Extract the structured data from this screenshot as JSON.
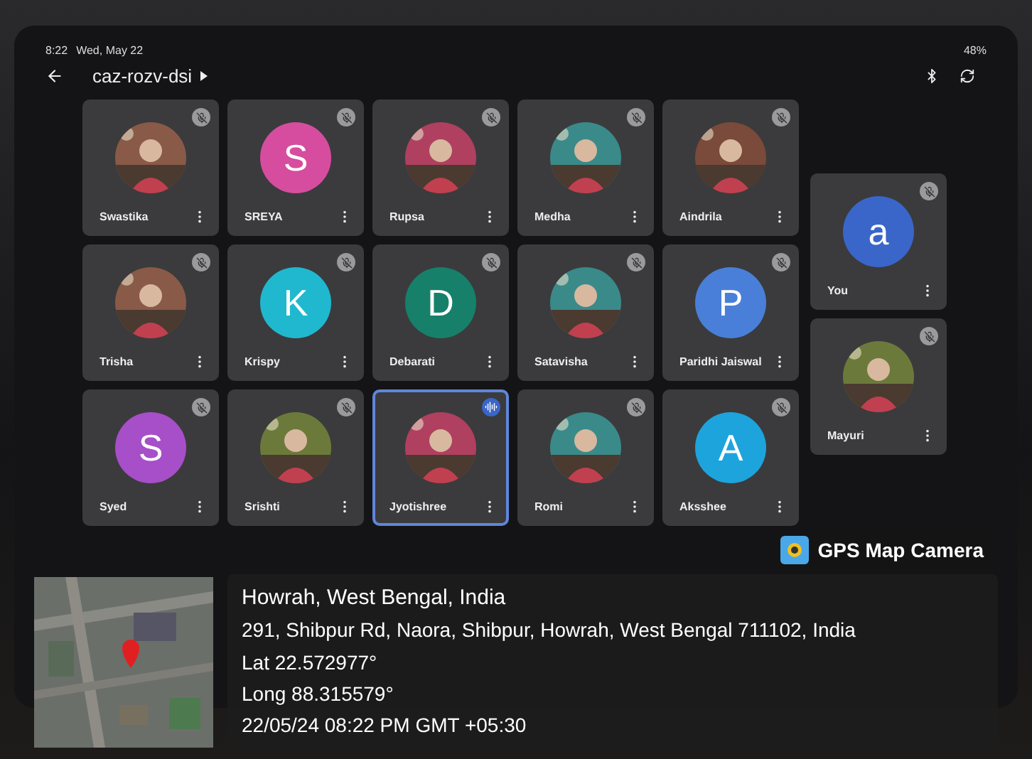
{
  "status_bar": {
    "time": "8:22",
    "date": "Wed, May 22",
    "battery": "48%"
  },
  "meeting": {
    "title": "caz-rozv-dsi"
  },
  "grid": [
    {
      "name": "Swastika",
      "muted": true,
      "speaking": false
    },
    {
      "name": "SREYA",
      "kind": "letter",
      "letter": "S",
      "color": "#d64d9f",
      "muted": true,
      "speaking": false
    },
    {
      "name": "Rupsa",
      "muted": true,
      "speaking": false
    },
    {
      "name": "Medha",
      "muted": true,
      "speaking": false
    },
    {
      "name": "Aindrila",
      "muted": true,
      "speaking": false
    },
    {
      "name": "Trisha",
      "muted": true,
      "speaking": false
    },
    {
      "name": "Krispy",
      "kind": "letter",
      "letter": "K",
      "color": "#20b8cf",
      "muted": true,
      "speaking": false
    },
    {
      "name": "Debarati",
      "kind": "letter",
      "letter": "D",
      "color": "#17806a",
      "muted": true,
      "speaking": false
    },
    {
      "name": "Satavisha",
      "muted": true,
      "speaking": false
    },
    {
      "name": "Paridhi Jaiswal",
      "kind": "letter",
      "letter": "P",
      "color": "#4a7fd9",
      "muted": true,
      "speaking": false
    },
    {
      "name": "Syed",
      "kind": "letter",
      "letter": "S",
      "color": "#a64fc8",
      "muted": true,
      "speaking": false
    },
    {
      "name": "Srishti",
      "muted": true,
      "speaking": false
    },
    {
      "name": "Jyotishree",
      "muted": false,
      "speaking": true
    },
    {
      "name": "Romi",
      "muted": true,
      "speaking": false
    },
    {
      "name": "Aksshee",
      "kind": "letter",
      "letter": "A",
      "color": "#1da4dc",
      "muted": true,
      "speaking": false
    }
  ],
  "side": [
    {
      "name": "You",
      "kind": "letter",
      "letter": "a",
      "color": "#3a66c9",
      "muted": true,
      "speaking": false
    },
    {
      "name": "Mayuri",
      "muted": true,
      "speaking": false
    }
  ],
  "gps": {
    "badge": "GPS Map Camera",
    "place": "Howrah, West Bengal, India",
    "address": "291, Shibpur Rd, Naora, Shibpur, Howrah, West Bengal 711102, India",
    "lat": "Lat 22.572977°",
    "long": "Long 88.315579°",
    "datetime": "22/05/24 08:22 PM GMT +05:30"
  }
}
